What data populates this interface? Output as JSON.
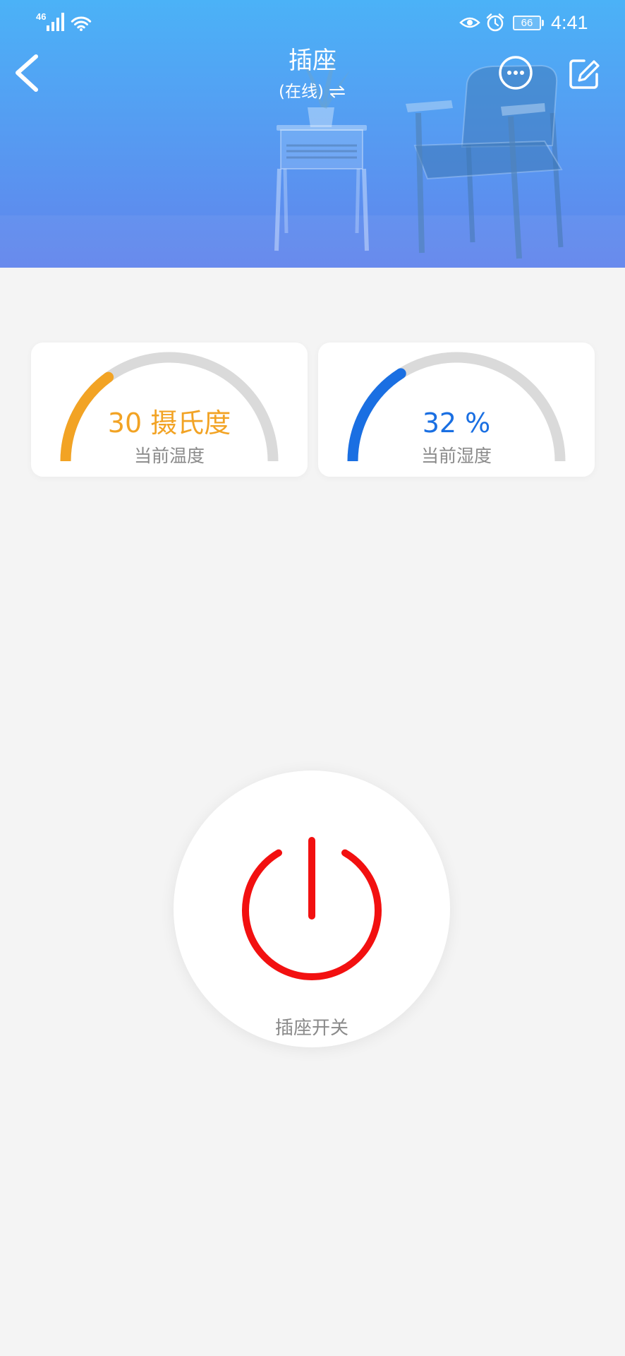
{
  "status_bar": {
    "network_type": "46",
    "battery_level": "66",
    "time": "4:41",
    "icons": [
      "signal-icon",
      "wifi-icon",
      "eye-icon",
      "alarm-icon",
      "battery-icon"
    ]
  },
  "header": {
    "title": "插座",
    "status": "(在线)",
    "icons": {
      "back": "chevron-left-icon",
      "switch": "swap-icon",
      "more": "more-icon",
      "edit": "edit-icon"
    }
  },
  "gauges": [
    {
      "value": "30",
      "unit": "摄氏度",
      "label": "当前温度",
      "fill_fraction": 0.3,
      "color": "#f2a324"
    },
    {
      "value": "32",
      "unit": "%",
      "label": "当前湿度",
      "fill_fraction": 0.32,
      "color": "#1a6fe2"
    }
  ],
  "power_switch": {
    "label": "插座开关",
    "icon": "power-icon",
    "color": "#f21010"
  },
  "colors": {
    "page_background": "#f4f4f4",
    "header_gradient_top": "#4bb2f7",
    "header_gradient_bottom": "#6184ec",
    "gauge_track": "#dadada",
    "label_gray": "#8a8a8a"
  }
}
